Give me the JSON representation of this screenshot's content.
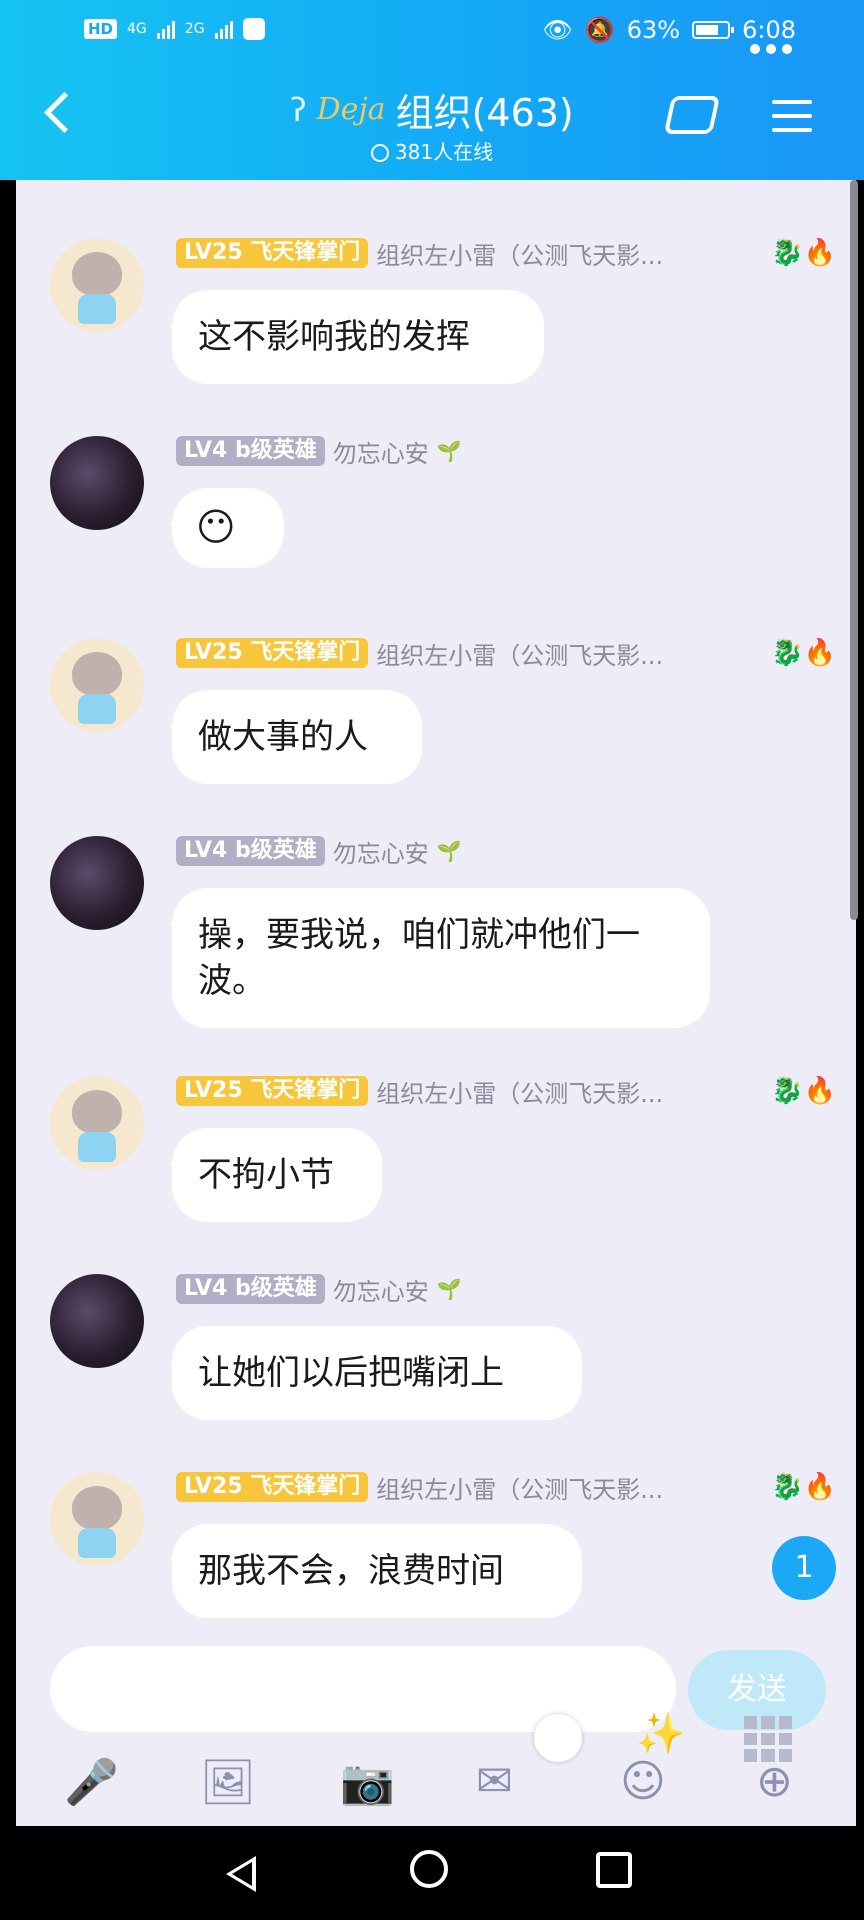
{
  "status_bar": {
    "left_chip": "HD",
    "net1": "4G",
    "net2": "2G",
    "battery": "63%",
    "time": "6:08"
  },
  "header": {
    "brand": "Deja",
    "group_name": "组织(463)",
    "online": "381人在线"
  },
  "messages": [
    {
      "level": "LV25 飞天锋掌门",
      "nick": "组织左小雷（公测飞天影...",
      "text": "这不影响我的发挥",
      "avatar": "cat",
      "icons": "🐉🔥"
    },
    {
      "level": "LV4 b级英雄",
      "nick": "勿忘心安",
      "text": "",
      "avatar": "dark",
      "leaf": "🌱"
    },
    {
      "level": "LV25 飞天锋掌门",
      "nick": "组织左小雷（公测飞天影...",
      "text": "做大事的人",
      "avatar": "cat",
      "icons": "🐉🔥"
    },
    {
      "level": "LV4 b级英雄",
      "nick": "勿忘心安",
      "text": "操，要我说，咱们就冲他们一波。",
      "avatar": "dark",
      "leaf": "🌱"
    },
    {
      "level": "LV25 飞天锋掌门",
      "nick": "组织左小雷（公测飞天影...",
      "text": "不拘小节",
      "avatar": "cat",
      "icons": "🐉🔥"
    },
    {
      "level": "LV4 b级英雄",
      "nick": "勿忘心安",
      "text": "让她们以后把嘴闭上",
      "avatar": "dark",
      "leaf": "🌱"
    },
    {
      "level": "LV25 飞天锋掌门",
      "nick": "组织左小雷（公测飞天影...",
      "text": "那我不会，浪费时间",
      "avatar": "cat",
      "icons": "🐉🔥"
    }
  ],
  "unread_count": "1",
  "input": {
    "send_label": "发送"
  },
  "toolbar": [
    "mic-icon",
    "image-icon",
    "camera-icon",
    "redpacket-icon",
    "emoji-icon",
    "plus-icon"
  ]
}
